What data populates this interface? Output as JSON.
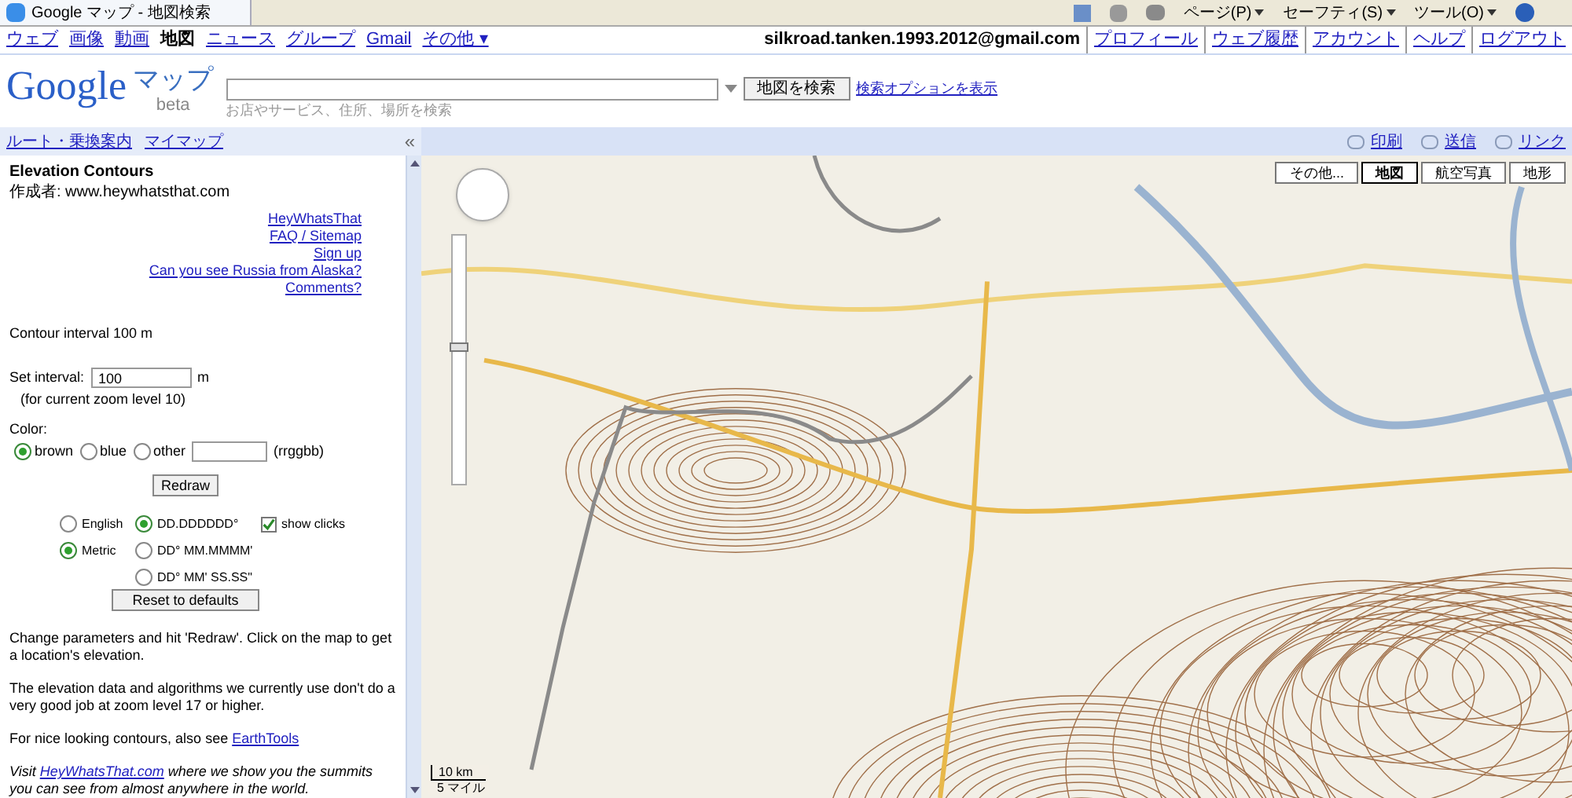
{
  "browser": {
    "tab_title": "Google マップ - 地図検索",
    "toolbar": [
      "ページ(P)",
      "セーフティ(S)",
      "ツール(O)"
    ]
  },
  "nav": {
    "items": [
      {
        "label": "ウェブ",
        "selected": false
      },
      {
        "label": "画像",
        "selected": false
      },
      {
        "label": "動画",
        "selected": false
      },
      {
        "label": "地図",
        "selected": true
      },
      {
        "label": "ニュース",
        "selected": false
      },
      {
        "label": "グループ",
        "selected": false
      },
      {
        "label": "Gmail",
        "selected": false
      },
      {
        "label": "その他 ▾",
        "selected": false
      }
    ],
    "account": "silkroad.tanken.1993.2012@gmail.com",
    "links": [
      "プロフィール",
      "ウェブ履歴",
      "アカウント",
      "ヘルプ",
      "ログアウト"
    ]
  },
  "header": {
    "logo": "Google",
    "product": "マップ",
    "beta": "beta",
    "search_hint": "お店やサービス、住所、場所を検索",
    "search_button": "地図を検索",
    "options_link": "検索オプションを表示"
  },
  "panel_bar": {
    "links": [
      "ルート・乗換案内",
      "マイマップ"
    ],
    "collapse": "«",
    "actions": [
      "印刷",
      "送信",
      "リンク"
    ]
  },
  "sidebar": {
    "title": "Elevation Contours",
    "author": "作成者: www.heywhatsthat.com",
    "links": [
      "HeyWhatsThat",
      "FAQ / Sitemap",
      "Sign up",
      "Can you see Russia from Alaska?",
      "Comments?"
    ],
    "interval_text": "Contour interval 100 m",
    "set_interval_label": "Set interval:",
    "interval_value": "100",
    "interval_unit": "m",
    "zoom_note": "(for current zoom level 10)",
    "color_label": "Color:",
    "colors": [
      {
        "label": "brown",
        "selected": true
      },
      {
        "label": "blue",
        "selected": false
      },
      {
        "label": "other",
        "selected": false
      }
    ],
    "color_hint": "(rrggbb)",
    "redraw": "Redraw",
    "units": [
      {
        "label": "English",
        "selected": false
      },
      {
        "label": "Metric",
        "selected": true
      }
    ],
    "formats": [
      {
        "label": "DD.DDDDDD°",
        "selected": true
      },
      {
        "label": "DD° MM.MMMM'",
        "selected": false
      },
      {
        "label": "DD° MM' SS.SS\"",
        "selected": false
      }
    ],
    "show_clicks": {
      "label": "show clicks",
      "checked": true
    },
    "reset": "Reset to defaults",
    "para_1": "Change parameters and hit 'Redraw'. Click on the map to get a location's elevation.",
    "para_2": "The elevation data and algorithms we currently use don't do a very good job at zoom level 17 or higher.",
    "para_3_text": "For nice looking contours, also see",
    "para_3_link": "EarthTools",
    "visit_before": "Visit",
    "visit_link": "HeyWhatsThat.com",
    "visit_after": "where we show you the summits you can see from almost anywhere in the world."
  },
  "map": {
    "zoom": {
      "level": 0.55
    },
    "types": [
      {
        "label": "その他...",
        "selected": false
      },
      {
        "label": "地図",
        "selected": true
      },
      {
        "label": "航空写真",
        "selected": false
      },
      {
        "label": "地形",
        "selected": false
      }
    ],
    "scale_km": "10 km",
    "scale_mi": "5 マイル"
  }
}
